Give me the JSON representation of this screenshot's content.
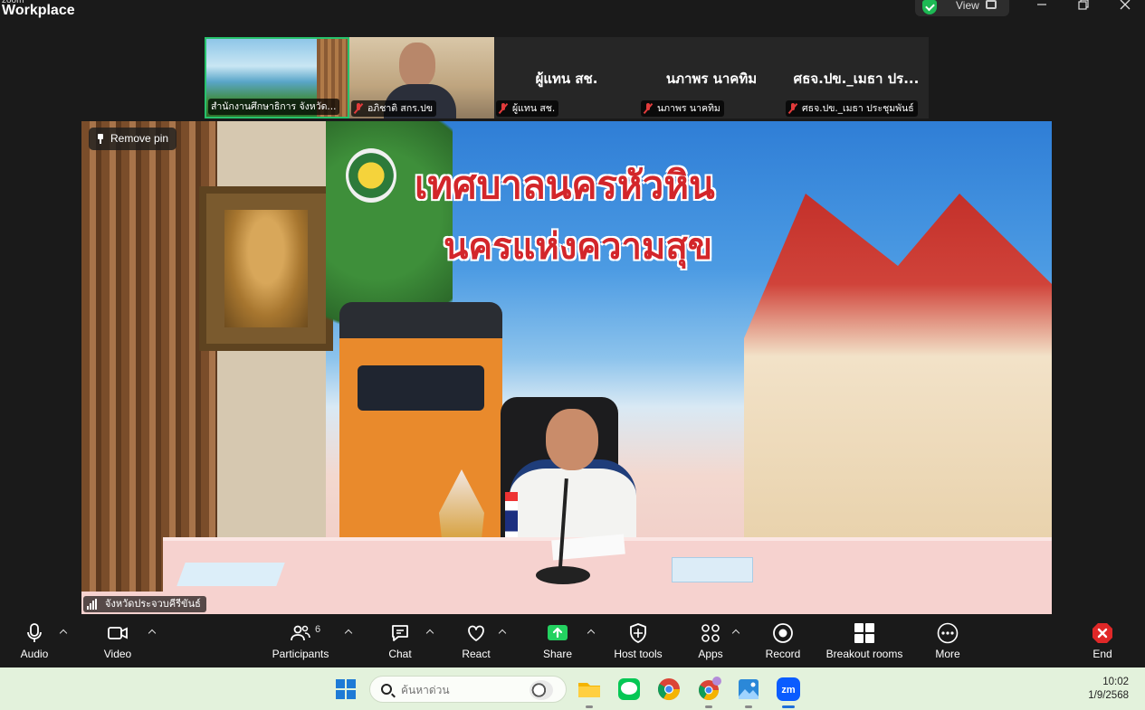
{
  "window": {
    "brand_sub": "zoom",
    "brand_main": "Workplace",
    "view_label": "View",
    "controls": [
      "minimize",
      "restore",
      "close"
    ]
  },
  "gallery": [
    {
      "label": "สำนักงานศึกษาธิการ จังหวัด...",
      "name": "",
      "muted": false,
      "active": true
    },
    {
      "label": "อภิชาติ สกร.ปข",
      "name": "",
      "muted": true,
      "active": false
    },
    {
      "label": "ผู้แทน สช.",
      "name": "ผู้แทน สช.",
      "muted": true,
      "active": false
    },
    {
      "label": "นภาพร นาคทิม",
      "name": "นภาพร  นาคทิม",
      "muted": true,
      "active": false
    },
    {
      "label": "ศธจ.ปข._เมธา ประชุมพันธ์",
      "name": "ศธจ.ปข._เมธา ปร...",
      "muted": true,
      "active": false
    }
  ],
  "main_video": {
    "remove_pin_label": "Remove pin",
    "speaker_label": "จังหวัดประจวบคีรีขันธ์",
    "banner_title": "เทศบาลนครหัวหิน",
    "banner_subtitle": "นครแห่งความสุข"
  },
  "toolbar": {
    "audio": "Audio",
    "video": "Video",
    "participants": "Participants",
    "participants_count": "6",
    "chat": "Chat",
    "react": "React",
    "share": "Share",
    "host_tools": "Host tools",
    "apps": "Apps",
    "record": "Record",
    "breakout_rooms": "Breakout rooms",
    "more": "More",
    "end": "End"
  },
  "colors": {
    "share_green": "#23d160",
    "end_red": "#e02828",
    "active_border": "#27c26c",
    "mute_red": "#e23b3b",
    "taskbar_bg": "#e3f2dc"
  },
  "taskbar": {
    "search_placeholder": "ค้นหาด่วน",
    "apps": [
      "windows-start-icon",
      "file-explorer-icon",
      "line-icon",
      "chrome-icon",
      "chrome-profile-icon",
      "photos-icon",
      "zoom-icon"
    ],
    "time": "10:02",
    "date": "1/9/2568"
  }
}
